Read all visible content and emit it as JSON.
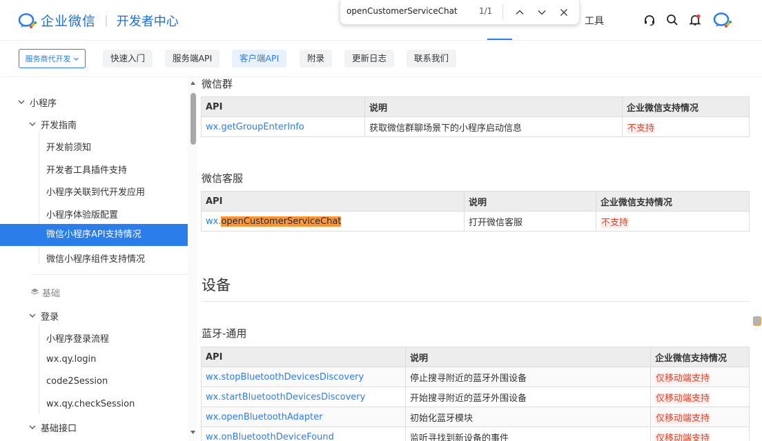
{
  "header": {
    "brand": "企业微信",
    "separator": "|",
    "subtitle": "开发者中心",
    "nav_tools": "工具",
    "accent": "#2b7de9"
  },
  "find_bar": {
    "query": "openCustomerServiceChat",
    "count": "1/1"
  },
  "subnav": {
    "dropdown_label": "服务商代开发",
    "tabs": [
      "快速入门",
      "服务端API",
      "客户端API",
      "附录",
      "更新日志",
      "联系我们"
    ],
    "active_tab": "客户端API"
  },
  "sidebar": {
    "items": [
      "小程序",
      "开发指南",
      "开发前须知",
      "开发者工具插件支持",
      "小程序关联到代开发应用",
      "小程序体验版配置",
      "微信小程序API支持情况",
      "微信小程序组件支持情况",
      "基础",
      "登录",
      "小程序登录流程",
      "wx.qy.login",
      "code2Session",
      "wx.qy.checkSession",
      "基础接口"
    ]
  },
  "content": {
    "group_heading": "微信群",
    "group_table": {
      "headers": [
        "API",
        "说明",
        "企业微信支持情况"
      ],
      "rows": [
        [
          "wx.getGroupEnterInfo",
          "获取微信群聊场景下的小程序启动信息",
          "不支持"
        ]
      ]
    },
    "service_heading": "微信客服",
    "service_table": {
      "headers": [
        "API",
        "说明",
        "企业微信支持情况"
      ],
      "rows": [
        [
          "wx.",
          "openCustomerServiceChat",
          "打开微信客服",
          "不支持"
        ]
      ]
    },
    "device_heading": "设备",
    "bt_heading": "蓝牙-通用",
    "bt_table": {
      "headers": [
        "API",
        "说明",
        "企业微信支持情况"
      ],
      "rows": [
        [
          "wx.stopBluetoothDevicesDiscovery",
          "停止搜寻附近的蓝牙外围设备",
          "仅移动端支持"
        ],
        [
          "wx.startBluetoothDevicesDiscovery",
          "开始搜寻附近的蓝牙外围设备",
          "仅移动端支持"
        ],
        [
          "wx.openBluetoothAdapter",
          "初始化蓝牙模块",
          "仅移动端支持"
        ],
        [
          "wx.onBluetoothDeviceFound",
          "监听寻找到新设备的事件",
          "仅移动端支持"
        ]
      ]
    }
  }
}
